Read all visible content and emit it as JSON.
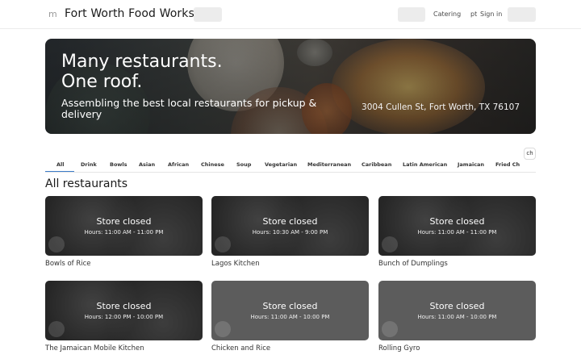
{
  "header": {
    "menu_glyph": "m",
    "brand": "Fort Worth Food Works",
    "nav": {
      "catering": "Catering",
      "lang": "pt",
      "sign_in": "Sign in"
    }
  },
  "hero": {
    "title": "Many restaurants.\nOne roof.",
    "subtitle": "Assembling the best local restaurants for pickup & delivery",
    "address": "3004 Cullen St, Fort Worth, TX 76107"
  },
  "tabs": [
    "All",
    "Drink",
    "Bowls",
    "Asian",
    "African",
    "Chinese",
    "Soup",
    "Vegetarian",
    "Mediterranean",
    "Caribbean",
    "Latin American",
    "Jamaican",
    "Fried Ch"
  ],
  "active_tab": "All",
  "tabs_scroll_label": "ch",
  "section_title": "All restaurants",
  "restaurants": [
    {
      "name": "Bowls of Rice",
      "status": "Store closed",
      "hours": "Hours: 11:00 AM - 11:00 PM"
    },
    {
      "name": "Lagos Kitchen",
      "status": "Store closed",
      "hours": "Hours: 10:30 AM - 9:00 PM"
    },
    {
      "name": "Bunch of Dumplings",
      "status": "Store closed",
      "hours": "Hours: 11:00 AM - 11:00 PM"
    },
    {
      "name": "The Jamaican Mobile Kitchen",
      "status": "Store closed",
      "hours": "Hours: 12:00 PM - 10:00 PM"
    },
    {
      "name": "Chicken and Rice",
      "status": "Store closed",
      "hours": "Hours: 11:00 AM - 10:00 PM"
    },
    {
      "name": "Rolling Gyro",
      "status": "Store closed",
      "hours": "Hours: 11:00 AM - 10:00 PM"
    }
  ],
  "colors": {
    "accent": "#3d7cc9",
    "card_overlay": "#5c5c5c"
  }
}
